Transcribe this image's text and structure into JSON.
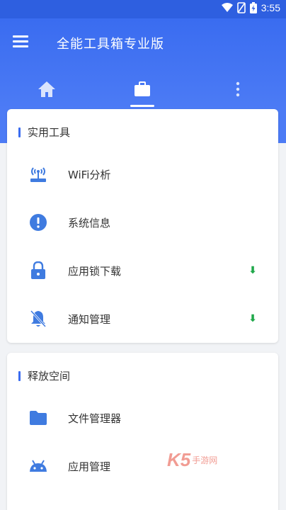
{
  "status_bar": {
    "time": "3:55"
  },
  "app_bar": {
    "title": "全能工具箱专业版",
    "tabs": [
      {
        "id": "home",
        "icon": "home-icon"
      },
      {
        "id": "tools",
        "icon": "briefcase-icon",
        "active": true
      },
      {
        "id": "more",
        "icon": "more-vert-icon"
      }
    ]
  },
  "sections": [
    {
      "title": "实用工具",
      "items": [
        {
          "label": "WiFi分析",
          "icon": "wifi-router-icon"
        },
        {
          "label": "系统信息",
          "icon": "info-alert-icon"
        },
        {
          "label": "应用锁下载",
          "icon": "lock-icon",
          "arrow": "⬇"
        },
        {
          "label": "通知管理",
          "icon": "bell-off-icon",
          "arrow": "⬇"
        }
      ]
    },
    {
      "title": "释放空间",
      "items": [
        {
          "label": "文件管理器",
          "icon": "folder-icon"
        },
        {
          "label": "应用管理",
          "icon": "android-icon"
        }
      ]
    }
  ],
  "watermark": {
    "brand": "K5",
    "text": "手游网"
  },
  "colors": {
    "primary": "#3a6cf0",
    "icon": "#3f7be0",
    "arrow": "#1fa84a"
  }
}
